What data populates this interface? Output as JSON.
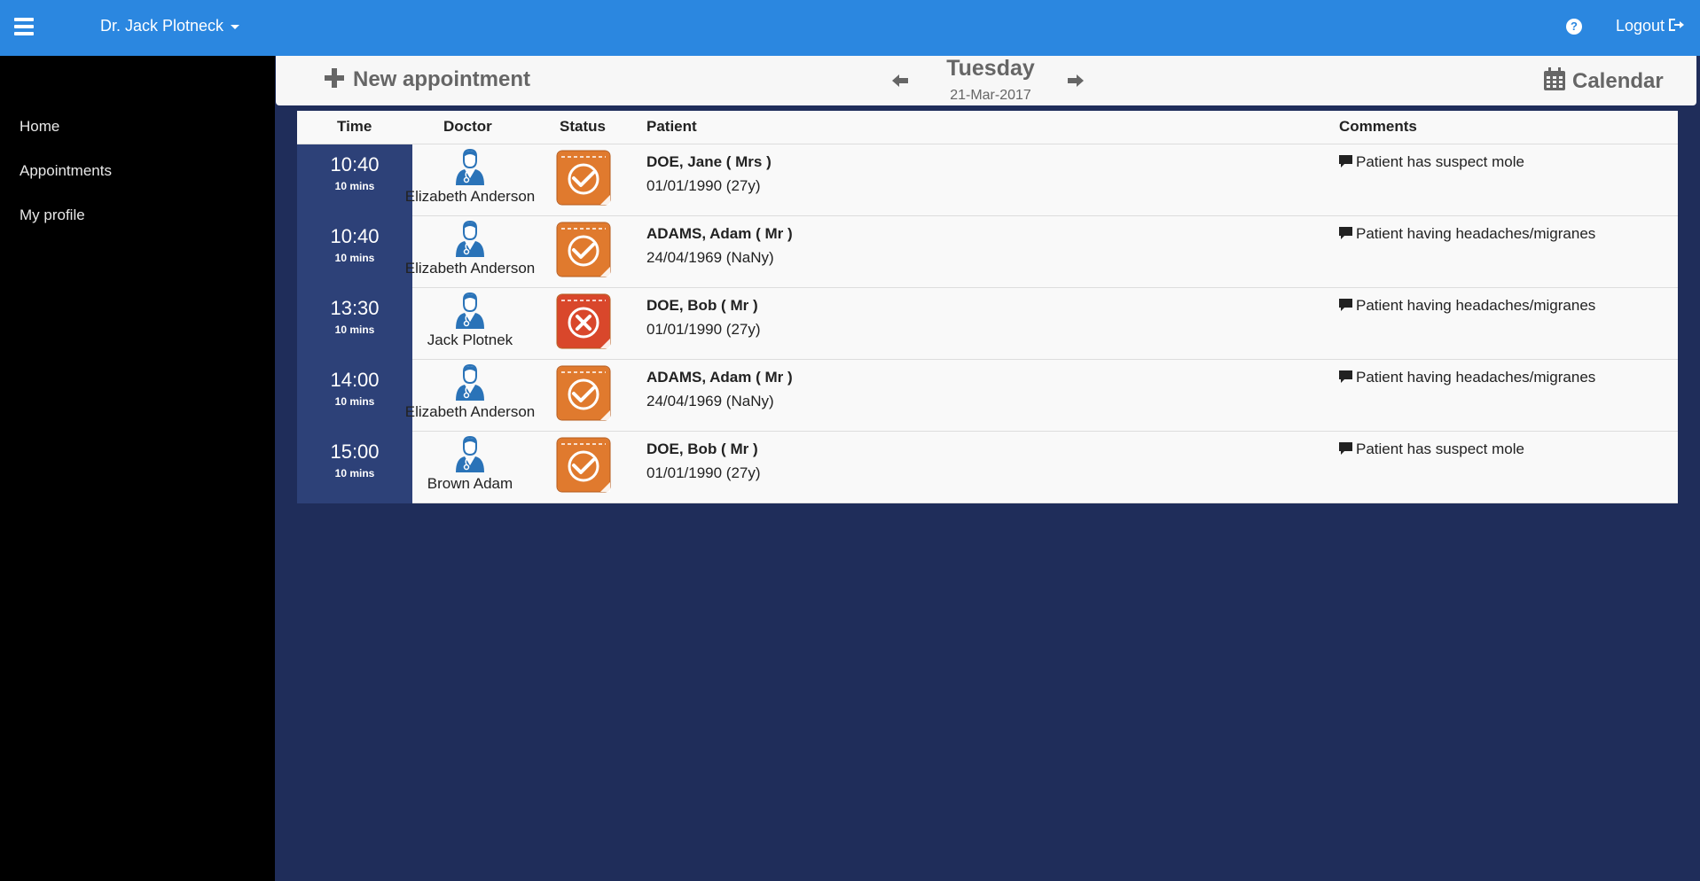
{
  "header": {
    "user_name": "Dr. Jack Plotneck",
    "logout_label": "Logout",
    "help_icon": "question-circle-icon",
    "menu_icon": "hamburger-icon",
    "bar_color": "#2b87e0"
  },
  "sidebar": {
    "items": [
      {
        "label": "Home"
      },
      {
        "label": "Appointments"
      },
      {
        "label": "My profile"
      }
    ]
  },
  "toolbar": {
    "new_appointment_label": "New appointment",
    "day_name": "Tuesday",
    "date": "21-Mar-2017",
    "calendar_label": "Calendar"
  },
  "table": {
    "columns": {
      "time": "Time",
      "doctor": "Doctor",
      "status": "Status",
      "patient": "Patient",
      "comments": "Comments"
    },
    "rows": [
      {
        "time": "10:40",
        "duration": "10 mins",
        "doctor": "Elizabeth Anderson",
        "status": "confirmed",
        "patient": "DOE, Jane ( Mrs )",
        "dob": "01/01/1990 (27y)",
        "comment": "Patient has suspect mole"
      },
      {
        "time": "10:40",
        "duration": "10 mins",
        "doctor": "Elizabeth Anderson",
        "status": "confirmed",
        "patient": "ADAMS, Adam ( Mr )",
        "dob": "24/04/1969 (NaNy)",
        "comment": "Patient having headaches/migranes"
      },
      {
        "time": "13:30",
        "duration": "10 mins",
        "doctor": "Jack Plotnek",
        "status": "cancelled",
        "patient": "DOE, Bob ( Mr )",
        "dob": "01/01/1990 (27y)",
        "comment": "Patient having headaches/migranes"
      },
      {
        "time": "14:00",
        "duration": "10 mins",
        "doctor": "Elizabeth Anderson",
        "status": "confirmed",
        "patient": "ADAMS, Adam ( Mr )",
        "dob": "24/04/1969 (NaNy)",
        "comment": "Patient having headaches/migranes"
      },
      {
        "time": "15:00",
        "duration": "10 mins",
        "doctor": "Brown Adam",
        "status": "confirmed",
        "patient": "DOE, Bob ( Mr )",
        "dob": "01/01/1990 (27y)",
        "comment": "Patient has suspect mole"
      }
    ]
  },
  "colors": {
    "confirmed": "#e07a2e",
    "cancelled": "#d9472b",
    "time_cell": "#2d4178",
    "background": "#1f2d5a"
  }
}
